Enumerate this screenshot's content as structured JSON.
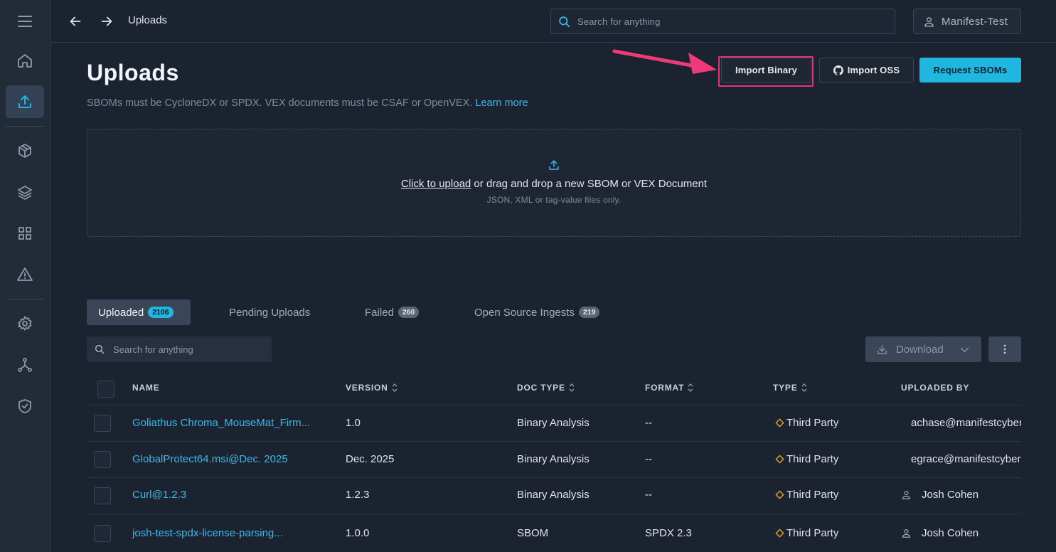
{
  "topbar": {
    "breadcrumb": "Uploads",
    "search_placeholder": "Search for anything",
    "user_label": "Manifest-Test"
  },
  "header": {
    "title": "Uploads",
    "subtitle": "SBOMs must be CycloneDX or SPDX. VEX documents must be CSAF or OpenVEX.",
    "learn_more": "Learn more",
    "buttons": {
      "import_binary": "Import Binary",
      "import_oss": "Import OSS",
      "request_sboms": "Request SBOMs"
    }
  },
  "dropzone": {
    "click_text": "Click to upload",
    "main_text": " or drag and drop a new SBOM or VEX Document",
    "sub_text": "JSON, XML or tag-value files only."
  },
  "tabs": [
    {
      "label": "Uploaded",
      "count": "2106"
    },
    {
      "label": "Pending Uploads",
      "count": ""
    },
    {
      "label": "Failed",
      "count": "260"
    },
    {
      "label": "Open Source Ingests",
      "count": "219"
    }
  ],
  "table_tools": {
    "search_placeholder": "Search for anything",
    "download_label": "Download"
  },
  "table": {
    "columns": [
      "NAME",
      "VERSION",
      "DOC TYPE",
      "FORMAT",
      "TYPE",
      "UPLOADED BY"
    ],
    "rows": [
      {
        "name": "Goliathus Chroma_MouseMat_Firm...",
        "version": "1.0",
        "doc_type": "Binary Analysis",
        "format": "--",
        "type": "Third Party",
        "uploaded_by": "achase@manifestcyber.com"
      },
      {
        "name": "GlobalProtect64.msi@Dec. 2025",
        "version": "Dec. 2025",
        "doc_type": "Binary Analysis",
        "format": "--",
        "type": "Third Party",
        "uploaded_by": "egrace@manifestcyber.com"
      },
      {
        "name": "Curl@1.2.3",
        "version": "1.2.3",
        "doc_type": "Binary Analysis",
        "format": "--",
        "type": "Third Party",
        "uploaded_by": "Josh Cohen"
      },
      {
        "name": "josh-test-spdx-license-parsing...",
        "version": "1.0.0",
        "doc_type": "SBOM",
        "format": "SPDX 2.3",
        "type": "Third Party",
        "uploaded_by": "Josh Cohen"
      }
    ]
  },
  "colors": {
    "accent": "#1fb6e0",
    "highlight": "#e8336f",
    "background": "#1b2330",
    "sidebar": "#222b38",
    "third_party_icon": "#e5a530"
  },
  "sidebar_icons": [
    "menu-icon",
    "home-icon",
    "upload-icon",
    "package-icon",
    "layers-icon",
    "grid-icon",
    "warning-icon",
    "settings-icon",
    "network-icon",
    "shield-check-icon"
  ]
}
